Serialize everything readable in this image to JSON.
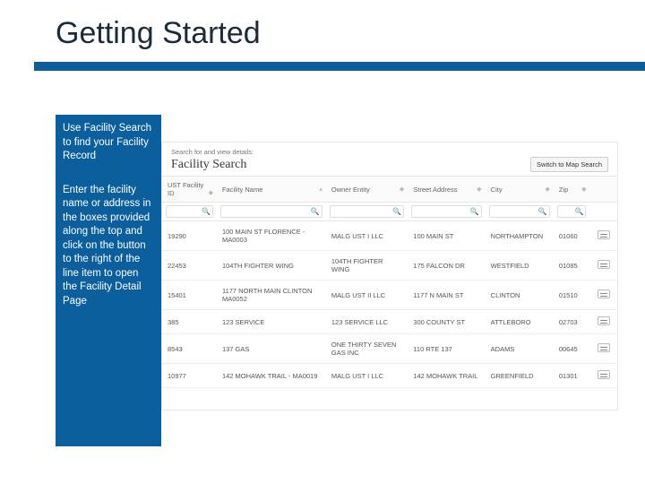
{
  "title": "Getting Started",
  "sidebar": {
    "blurb1": "Use Facility Search to find your Facility Record",
    "blurb2": "Enter the facility name or address in the boxes provided along the top and click on the button to the right of the line item to open the Facility Detail Page"
  },
  "panel": {
    "pre": "Search for and view details:",
    "heading": "Facility Search",
    "switch": "Switch to Map Search"
  },
  "columns": [
    "UST Facility ID",
    "Facility Name",
    "Owner Entity",
    "Street Address",
    "City",
    "Zip"
  ],
  "rows": [
    {
      "id": "19290",
      "name": "100 MAIN ST FLORENCE - MA0003",
      "owner": "MALG UST I LLC",
      "addr": "100 MAIN ST",
      "city": "NORTHAMPTON",
      "zip": "01060"
    },
    {
      "id": "22453",
      "name": "104TH FIGHTER WING",
      "owner": "104TH FIGHTER WING",
      "addr": "175 FALCON DR",
      "city": "WESTFIELD",
      "zip": "01085"
    },
    {
      "id": "15401",
      "name": "1177 NORTH MAIN CLINTON MA0052",
      "owner": "MALG UST II LLC",
      "addr": "1177 N MAIN ST",
      "city": "CLINTON",
      "zip": "01510"
    },
    {
      "id": "385",
      "name": "123 SERVICE",
      "owner": "123 SERVICE LLC",
      "addr": "300 COUNTY ST",
      "city": "ATTLEBORO",
      "zip": "02703"
    },
    {
      "id": "8543",
      "name": "137 GAS",
      "owner": "ONE THIRTY SEVEN GAS INC",
      "addr": "110 RTE 137",
      "city": "ADAMS",
      "zip": "00645"
    },
    {
      "id": "10977",
      "name": "142 MOHAWK TRAIL - MA0019",
      "owner": "MALG UST I LLC",
      "addr": "142 MOHAWK TRAIL",
      "city": "GREENFIELD",
      "zip": "01301"
    }
  ]
}
